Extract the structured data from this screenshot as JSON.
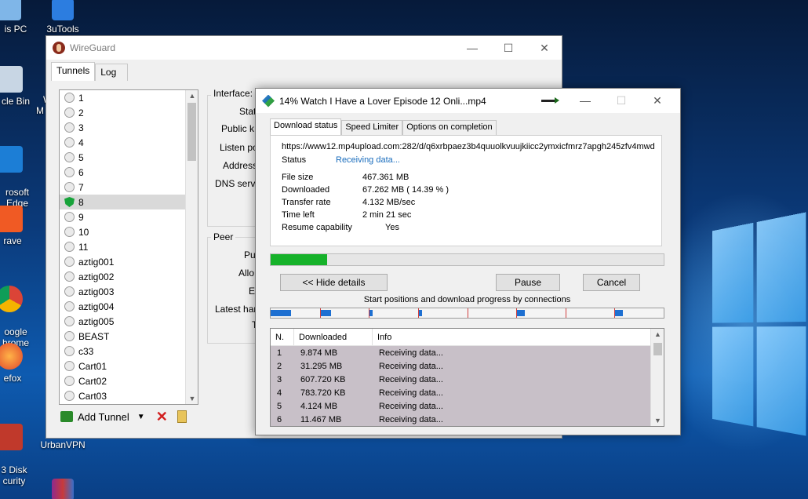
{
  "desktop": {
    "icons": [
      {
        "id": "this-pc",
        "label": "is PC"
      },
      {
        "id": "3utools",
        "label": "3uTools"
      },
      {
        "id": "recycle-bin",
        "label": "cle Bin"
      },
      {
        "id": "edge",
        "label": "rosoft\nEdge"
      },
      {
        "id": "brave",
        "label": "rave"
      },
      {
        "id": "chrome",
        "label": "oogle\nhrome"
      },
      {
        "id": "firefox",
        "label": "efox"
      },
      {
        "id": "disk-security",
        "label": "3 Disk\ncurity"
      },
      {
        "id": "urbanvpn",
        "label": "UrbanVPN"
      }
    ],
    "partial_label_w": "W",
    "partial_label_m": "M"
  },
  "wireguard": {
    "title": "WireGuard",
    "tabs": [
      "Tunnels",
      "Log"
    ],
    "tunnels": [
      {
        "name": "1",
        "active": false
      },
      {
        "name": "2",
        "active": false
      },
      {
        "name": "3",
        "active": false
      },
      {
        "name": "4",
        "active": false
      },
      {
        "name": "5",
        "active": false
      },
      {
        "name": "6",
        "active": false
      },
      {
        "name": "7",
        "active": false
      },
      {
        "name": "8",
        "active": true
      },
      {
        "name": "9",
        "active": false
      },
      {
        "name": "10",
        "active": false
      },
      {
        "name": "11",
        "active": false
      },
      {
        "name": "aztig001",
        "active": false
      },
      {
        "name": "aztig002",
        "active": false
      },
      {
        "name": "aztig003",
        "active": false
      },
      {
        "name": "aztig004",
        "active": false
      },
      {
        "name": "aztig005",
        "active": false
      },
      {
        "name": "BEAST",
        "active": false
      },
      {
        "name": "c33",
        "active": false
      },
      {
        "name": "Cart01",
        "active": false
      },
      {
        "name": "Cart02",
        "active": false
      },
      {
        "name": "Cart03",
        "active": false
      }
    ],
    "add_tunnel_label": "Add Tunnel",
    "interface": {
      "title": "Interface: :",
      "labels": [
        "Stat",
        "Public k",
        "Listen po",
        "Address",
        "DNS serve"
      ]
    },
    "peer": {
      "title": "Peer",
      "labels": [
        "Pu",
        "Allo",
        "Er",
        "Latest har",
        "T"
      ]
    },
    "titlebar_buttons": {
      "minimize": "—",
      "maximize": "☐",
      "close": "✕"
    }
  },
  "idm": {
    "title": "14% Watch I Have a Lover Episode 12 Onli...mp4",
    "titlebar_buttons": {
      "minimize": "—",
      "maximize": "☐",
      "close": "✕"
    },
    "tabs": [
      "Download status",
      "Speed Limiter",
      "Options on completion"
    ],
    "url": "https://www12.mp4upload.com:282/d/q6xrbpaez3b4quuolkvuujkiicc2ymxicfmrz7apgh245zfv4mwd",
    "status_label": "Status",
    "status_value": "Receiving data...",
    "fields": [
      {
        "label": "File size",
        "value": "467.361  MB"
      },
      {
        "label": "Downloaded",
        "value": "67.262  MB  ( 14.39 % )"
      },
      {
        "label": "Transfer rate",
        "value": "4.132  MB/sec"
      },
      {
        "label": "Time left",
        "value": "2 min 21 sec"
      },
      {
        "label": "Resume capability",
        "value": "Yes"
      }
    ],
    "progress_percent": 14.39,
    "buttons": {
      "hide_details": "<< Hide details",
      "pause": "Pause",
      "cancel": "Cancel"
    },
    "connections_caption": "Start positions and download progress by connections",
    "connection_segments": [
      0.14,
      0.07,
      0.02,
      0.02,
      0.0,
      0.05,
      0.0,
      0.05
    ],
    "table": {
      "headers": [
        "N.",
        "Downloaded",
        "Info"
      ],
      "rows": [
        {
          "n": "1",
          "downloaded": "9.874  MB",
          "info": "Receiving data..."
        },
        {
          "n": "2",
          "downloaded": "31.295  MB",
          "info": "Receiving data..."
        },
        {
          "n": "3",
          "downloaded": "607.720  KB",
          "info": "Receiving data..."
        },
        {
          "n": "4",
          "downloaded": "783.720  KB",
          "info": "Receiving data..."
        },
        {
          "n": "5",
          "downloaded": "4.124  MB",
          "info": "Receiving data..."
        },
        {
          "n": "6",
          "downloaded": "11.467  MB",
          "info": "Receiving data..."
        }
      ]
    },
    "colors": {
      "progress": "#16b22a",
      "row_bg": "#c8c0c8",
      "link": "#1a6dbd"
    }
  }
}
